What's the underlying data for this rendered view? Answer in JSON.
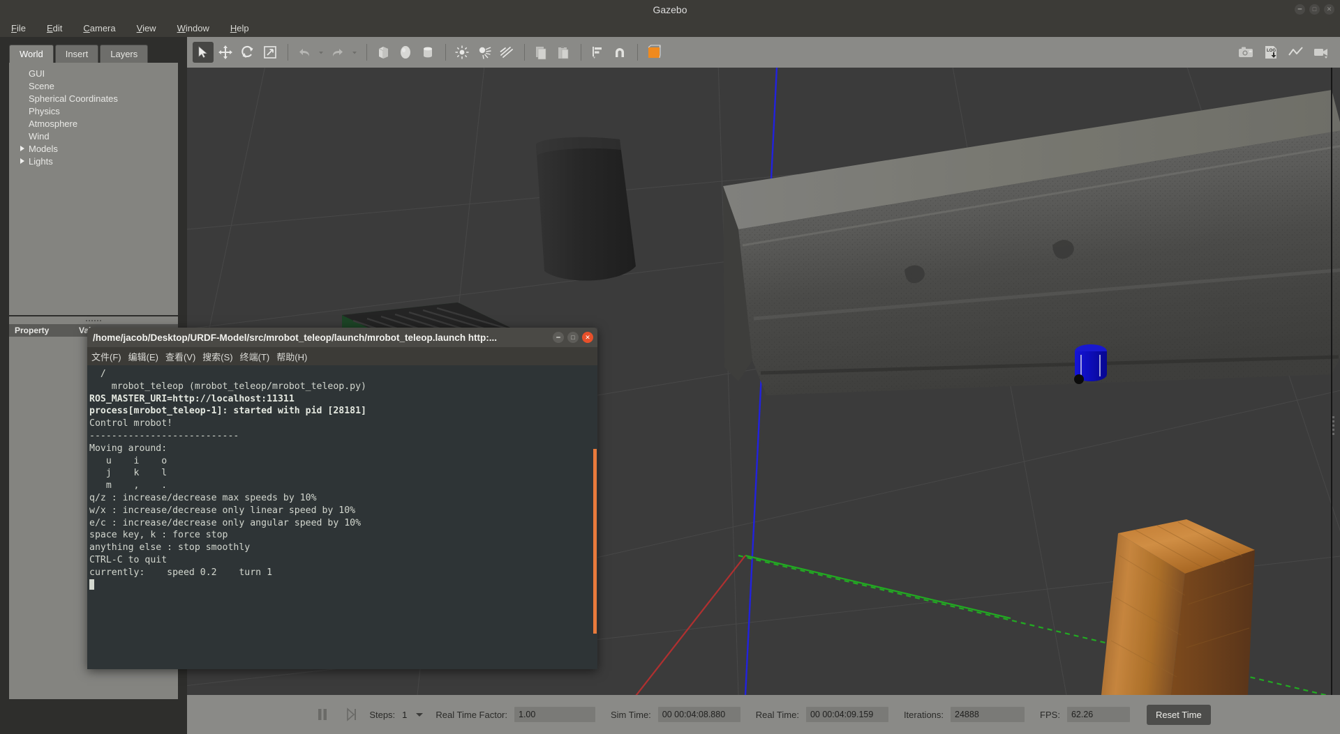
{
  "window": {
    "title": "Gazebo",
    "controls": [
      "minimize",
      "maximize",
      "close"
    ]
  },
  "menubar": {
    "items": [
      {
        "label": "File",
        "accel": "F"
      },
      {
        "label": "Edit",
        "accel": "E"
      },
      {
        "label": "Camera",
        "accel": "C"
      },
      {
        "label": "View",
        "accel": "V"
      },
      {
        "label": "Window",
        "accel": "W"
      },
      {
        "label": "Help",
        "accel": "H"
      }
    ]
  },
  "left_panel": {
    "tabs": [
      {
        "label": "World",
        "active": true
      },
      {
        "label": "Insert",
        "active": false
      },
      {
        "label": "Layers",
        "active": false
      }
    ],
    "tree": [
      {
        "label": "GUI",
        "expandable": false
      },
      {
        "label": "Scene",
        "expandable": false
      },
      {
        "label": "Spherical Coordinates",
        "expandable": false
      },
      {
        "label": "Physics",
        "expandable": false
      },
      {
        "label": "Atmosphere",
        "expandable": false
      },
      {
        "label": "Wind",
        "expandable": false
      },
      {
        "label": "Models",
        "expandable": true
      },
      {
        "label": "Lights",
        "expandable": true
      }
    ],
    "property_table": {
      "columns": [
        "Property",
        "Value"
      ],
      "rows": []
    }
  },
  "toolbar": {
    "left_tools": [
      {
        "name": "select-mode",
        "icon": "cursor-arrow-icon",
        "active": true
      },
      {
        "name": "translate-mode",
        "icon": "move-arrows-icon",
        "active": false
      },
      {
        "name": "rotate-mode",
        "icon": "rotate-icon",
        "active": false
      },
      {
        "name": "scale-mode",
        "icon": "scale-icon",
        "active": false
      },
      {
        "name": "undo",
        "icon": "undo-arrow-icon",
        "active": false
      },
      {
        "name": "undo-history",
        "icon": "chevron-down-icon",
        "active": false
      },
      {
        "name": "redo",
        "icon": "redo-arrow-icon",
        "active": false
      },
      {
        "name": "redo-history",
        "icon": "chevron-down-icon",
        "active": false
      },
      {
        "name": "insert-box",
        "icon": "box-icon",
        "active": false
      },
      {
        "name": "insert-sphere",
        "icon": "sphere-icon",
        "active": false
      },
      {
        "name": "insert-cylinder",
        "icon": "cylinder-icon",
        "active": false
      },
      {
        "name": "insert-point-light",
        "icon": "point-light-icon",
        "active": false
      },
      {
        "name": "insert-spot-light",
        "icon": "spot-light-icon",
        "active": false
      },
      {
        "name": "insert-directional-light",
        "icon": "directional-light-icon",
        "active": false
      },
      {
        "name": "copy",
        "icon": "copy-icon",
        "active": false
      },
      {
        "name": "paste",
        "icon": "paste-icon",
        "active": false
      },
      {
        "name": "align",
        "icon": "align-icon",
        "active": false
      },
      {
        "name": "snap",
        "icon": "magnet-icon",
        "active": false
      },
      {
        "name": "view-angle",
        "icon": "orange-cube-icon",
        "active": false
      }
    ],
    "right_tools": [
      {
        "name": "screenshot",
        "icon": "camera-icon"
      },
      {
        "name": "log-record",
        "icon": "log-download-icon"
      },
      {
        "name": "plot",
        "icon": "plot-line-icon"
      },
      {
        "name": "video-record",
        "icon": "video-camera-icon"
      }
    ]
  },
  "scene": {
    "objects": [
      {
        "name": "jersey-barrier",
        "description": "concrete barrier"
      },
      {
        "name": "mrobot",
        "description": "blue cylindrical robot",
        "color": "#0a0ac8"
      },
      {
        "name": "dumpster",
        "description": "green dumpster",
        "color": "#1e4a28"
      },
      {
        "name": "trash-bin",
        "description": "dark cylinder"
      },
      {
        "name": "wooden-box",
        "description": "wood texture box",
        "color": "#b5722c"
      }
    ],
    "axes": {
      "x_color": "#b03030",
      "y_color": "#2aa02a",
      "z_color": "#2222dd"
    },
    "grid_color": "#4a4a4a",
    "background": "#3b3b3b"
  },
  "statusbar": {
    "pause_icon": "pause-icon",
    "step_icon": "step-forward-icon",
    "steps_label": "Steps:",
    "steps_value": "1",
    "rtf_label": "Real Time Factor:",
    "rtf_value": "1.00",
    "sim_time_label": "Sim Time:",
    "sim_time_value": "00 00:04:08.880",
    "real_time_label": "Real Time:",
    "real_time_value": "00 00:04:09.159",
    "iterations_label": "Iterations:",
    "iterations_value": "24888",
    "fps_label": "FPS:",
    "fps_value": "62.26",
    "reset_button": "Reset Time"
  },
  "terminal": {
    "title": "/home/jacob/Desktop/URDF-Model/src/mrobot_teleop/launch/mrobot_teleop.launch http:...",
    "menu": [
      "文件(F)",
      "编辑(E)",
      "查看(V)",
      "搜索(S)",
      "终端(T)",
      "帮助(H)"
    ],
    "lines": [
      {
        "text": "  /",
        "bold": false
      },
      {
        "text": "    mrobot_teleop (mrobot_teleop/mrobot_teleop.py)",
        "bold": false
      },
      {
        "text": "",
        "bold": false
      },
      {
        "text": "ROS_MASTER_URI=http://localhost:11311",
        "bold": true
      },
      {
        "text": "",
        "bold": false
      },
      {
        "text": "process[mrobot_teleop-1]: started with pid [28181]",
        "bold": true
      },
      {
        "text": "",
        "bold": false
      },
      {
        "text": "Control mrobot!",
        "bold": false
      },
      {
        "text": "---------------------------",
        "bold": false
      },
      {
        "text": "Moving around:",
        "bold": false
      },
      {
        "text": "   u    i    o",
        "bold": false
      },
      {
        "text": "   j    k    l",
        "bold": false
      },
      {
        "text": "   m    ,    .",
        "bold": false
      },
      {
        "text": "",
        "bold": false
      },
      {
        "text": "q/z : increase/decrease max speeds by 10%",
        "bold": false
      },
      {
        "text": "w/x : increase/decrease only linear speed by 10%",
        "bold": false
      },
      {
        "text": "e/c : increase/decrease only angular speed by 10%",
        "bold": false
      },
      {
        "text": "space key, k : force stop",
        "bold": false
      },
      {
        "text": "anything else : stop smoothly",
        "bold": false
      },
      {
        "text": "",
        "bold": false
      },
      {
        "text": "CTRL-C to quit",
        "bold": false
      },
      {
        "text": "",
        "bold": false
      },
      {
        "text": "currently:\tspeed 0.2\tturn 1",
        "bold": false
      }
    ],
    "window_controls": [
      "minimize",
      "maximize",
      "close"
    ]
  }
}
